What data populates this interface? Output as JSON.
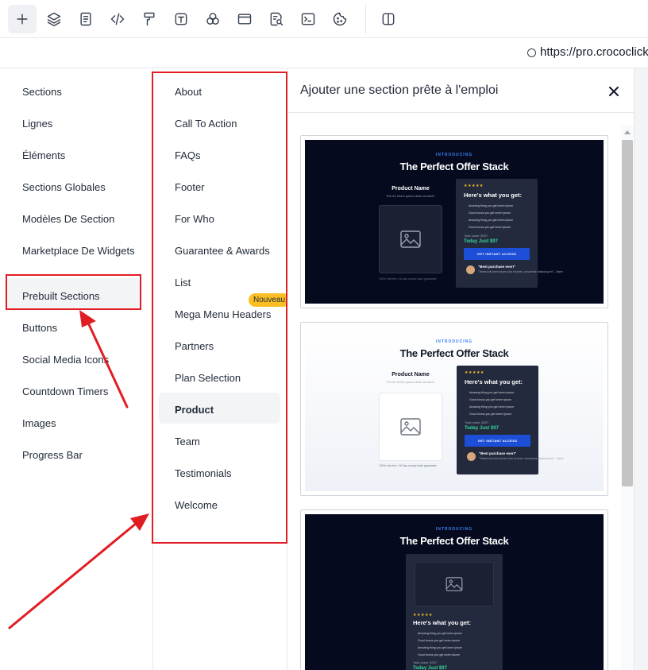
{
  "toolbar": {
    "buttons": [
      {
        "name": "add-icon",
        "active": true
      },
      {
        "name": "layers-icon"
      },
      {
        "name": "page-icon"
      },
      {
        "name": "code-icon"
      },
      {
        "name": "paint-roller-icon"
      },
      {
        "name": "text-icon"
      },
      {
        "name": "shapes-icon"
      },
      {
        "name": "browser-window-icon"
      },
      {
        "name": "search-document-icon"
      },
      {
        "name": "terminal-icon"
      },
      {
        "name": "cookie-icon"
      },
      {
        "name": "split-panel-icon"
      }
    ]
  },
  "urlbar": {
    "url": "https://pro.crococlick"
  },
  "left_panel": {
    "items": [
      "Sections",
      "Lignes",
      "Éléments",
      "Sections Globales",
      "Modèles De Section",
      "Marketplace De Widgets",
      "Prebuilt Sections",
      "Buttons",
      "Social Media Icons",
      "Countdown Timers",
      "Images",
      "Progress Bar"
    ],
    "active": "Prebuilt Sections"
  },
  "middle_panel": {
    "items": [
      "About",
      "Call To Action",
      "FAQs",
      "Footer",
      "For Who",
      "Guarantee & Awards",
      "List",
      "Mega Menu Headers",
      "Partners",
      "Plan Selection",
      "Product",
      "Team",
      "Testimonials",
      "Welcome"
    ],
    "active": "Product",
    "badge": "Nouveau"
  },
  "right_panel": {
    "title": "Ajouter une section prête à l'emploi",
    "close_icon": "close-icon"
  },
  "preview": {
    "intro": "INTRODUCING",
    "title": "The Perfect Offer Stack",
    "product_name": "Product Name",
    "product_sub": "The #1 lorem ipsum dolor sit amet.",
    "guarantee": "100% risk free • 30 day money back guarantee",
    "stars": "★★★★★",
    "whats_included": "Here's what you get:",
    "bullets": [
      "Amazing thing you get lorem ipsum",
      "Good bonus you get lorem ipsum",
      "Amazing thing you get lorem ipsum",
      "Good bonus you get lorem ipsum"
    ],
    "total_value": "Total value: $297",
    "today": "Today Just $97",
    "cta": "GET INSTANT ACCESS",
    "quote": "\"Best purchase ever!\"",
    "quote_sub": "\"Testimonial lorem ipsum dolor sit amet, consectetur adipiscing elit\" – Name"
  },
  "colors": {
    "annotation": "#e11d24",
    "badge": "#fbbf24",
    "cta": "#1d4ed8",
    "dark_bg": "#050a1f"
  }
}
